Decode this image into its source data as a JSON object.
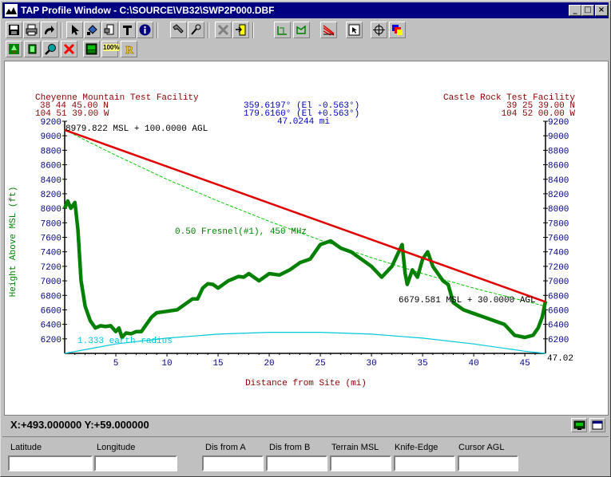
{
  "window": {
    "title": "TAP Profile Window - C:\\SOURCE\\VB32\\SWP2P000.DBF",
    "controls": [
      "_",
      "□",
      "×"
    ]
  },
  "toolbar1": [
    "save-icon",
    "print-icon",
    "redo-arrow-icon",
    "pointer-icon",
    "paint-bucket-icon",
    "printer-doc-icon",
    "text-tool-icon",
    "info-icon",
    "wrench-icon",
    "tools-icon",
    "delete-icon",
    "exit-door-icon",
    "profile-green-icon",
    "profile-green2-icon",
    "profile-red-icon",
    "select-tool-icon",
    "crosshair-icon",
    "color-palette-icon"
  ],
  "toolbar2": {
    "zoom_label": "100%",
    "icons": [
      "tree-icon",
      "green-square-icon",
      "magnifier-icon",
      "red-x-icon",
      "image-icon",
      "zoom100-icon",
      "r-icon"
    ]
  },
  "site_a": {
    "name": "Cheyenne Mountain Test Facility",
    "lat": "38 44 45.00 N",
    "lon": "104 51 39.00 W"
  },
  "site_b": {
    "name": "Castle Rock Test Facility",
    "lat": "39 25 39.00 N",
    "lon": "104 52 00.00 W"
  },
  "bearing": {
    "az1": "359.6197° (El -0.563°)",
    "az2": "179.6160° (El +0.563°)",
    "distance": "47.0244 mi"
  },
  "annotations": {
    "left_height": "8979.822 MSL + 100.0000 AGL",
    "right_height": "6679.581 MSL + 30.0000 AGL",
    "fresnel": "0.50 Fresnel(#1), 450 MHz",
    "earth": "1.333 earth radius",
    "end_distance": "47.02"
  },
  "chart_data": {
    "type": "line",
    "xlabel": "Distance from Site (mi)",
    "ylabel": "Height Above MSL (ft)",
    "xlim": [
      0,
      47.02
    ],
    "ylim": [
      6000,
      9200
    ],
    "xticks": [
      5,
      10,
      15,
      20,
      25,
      30,
      35,
      40,
      45
    ],
    "yticks": [
      6200,
      6400,
      6600,
      6800,
      7000,
      7200,
      7400,
      7600,
      7800,
      8000,
      8200,
      8400,
      8600,
      8800,
      9000,
      9200
    ],
    "series": [
      {
        "name": "terrain",
        "color": "#008000",
        "x": [
          0,
          0.3,
          0.6,
          1.0,
          1.3,
          1.6,
          2.0,
          2.5,
          3.0,
          3.5,
          4.0,
          4.5,
          5.0,
          5.3,
          5.6,
          6.0,
          6.5,
          7.0,
          7.5,
          8.0,
          8.5,
          9.0,
          9.5,
          10.0,
          11.0,
          12.0,
          12.5,
          13.0,
          13.5,
          14.0,
          14.5,
          15.0,
          16.0,
          17.0,
          17.5,
          18.0,
          18.5,
          19.0,
          20.0,
          21.0,
          22.0,
          23.0,
          24.0,
          25.0,
          26.0,
          27.0,
          28.0,
          29.0,
          30.0,
          31.0,
          32.0,
          32.5,
          33.0,
          33.3,
          33.5,
          34.0,
          34.5,
          35.0,
          35.5,
          36.0,
          36.5,
          37.0,
          37.5,
          38.0,
          39.0,
          40.0,
          41.0,
          42.0,
          43.0,
          44.0,
          45.0,
          45.8,
          46.3,
          46.7,
          47.02
        ],
        "y": [
          8000,
          8100,
          8000,
          8080,
          7700,
          7000,
          6650,
          6450,
          6350,
          6380,
          6370,
          6380,
          6300,
          6350,
          6220,
          6280,
          6270,
          6300,
          6300,
          6400,
          6500,
          6560,
          6570,
          6580,
          6600,
          6700,
          6750,
          6750,
          6900,
          6960,
          6950,
          6900,
          7000,
          7060,
          7050,
          7100,
          7050,
          7000,
          7100,
          7080,
          7150,
          7250,
          7300,
          7500,
          7550,
          7450,
          7400,
          7300,
          7200,
          7050,
          7200,
          7350,
          7500,
          7100,
          6950,
          7150,
          7050,
          7300,
          7400,
          7200,
          7100,
          7000,
          6950,
          6700,
          6600,
          6550,
          6500,
          6450,
          6400,
          6250,
          6220,
          6250,
          6350,
          6500,
          6720
        ]
      },
      {
        "name": "line-of-sight",
        "color": "#e00000",
        "x": [
          0,
          47.02
        ],
        "y": [
          9080,
          6710
        ]
      },
      {
        "name": "fresnel",
        "color": "#00cc00",
        "x": [
          0,
          5,
          10,
          15,
          20,
          25,
          30,
          35,
          40,
          45,
          47.02
        ],
        "y": [
          9080,
          8730,
          8400,
          8100,
          7820,
          7560,
          7320,
          7100,
          6900,
          6720,
          6650
        ]
      },
      {
        "name": "earth-curve",
        "color": "#00c8d8",
        "x": [
          0,
          5,
          10,
          15,
          20,
          25,
          30,
          35,
          40,
          45,
          47.02
        ],
        "y": [
          6000,
          6130,
          6210,
          6265,
          6290,
          6290,
          6265,
          6210,
          6130,
          6030,
          6000
        ]
      }
    ]
  },
  "status": {
    "coords": "X:+493.000000 Y:+59.000000"
  },
  "fields": [
    {
      "label": "Latitude",
      "value": ""
    },
    {
      "label": "Longitude",
      "value": ""
    },
    {
      "label": "Dis from A",
      "value": ""
    },
    {
      "label": "Dis from B",
      "value": ""
    },
    {
      "label": "Terrain MSL",
      "value": ""
    },
    {
      "label": "Knife-Edge",
      "value": ""
    },
    {
      "label": "Cursor AGL",
      "value": ""
    }
  ]
}
